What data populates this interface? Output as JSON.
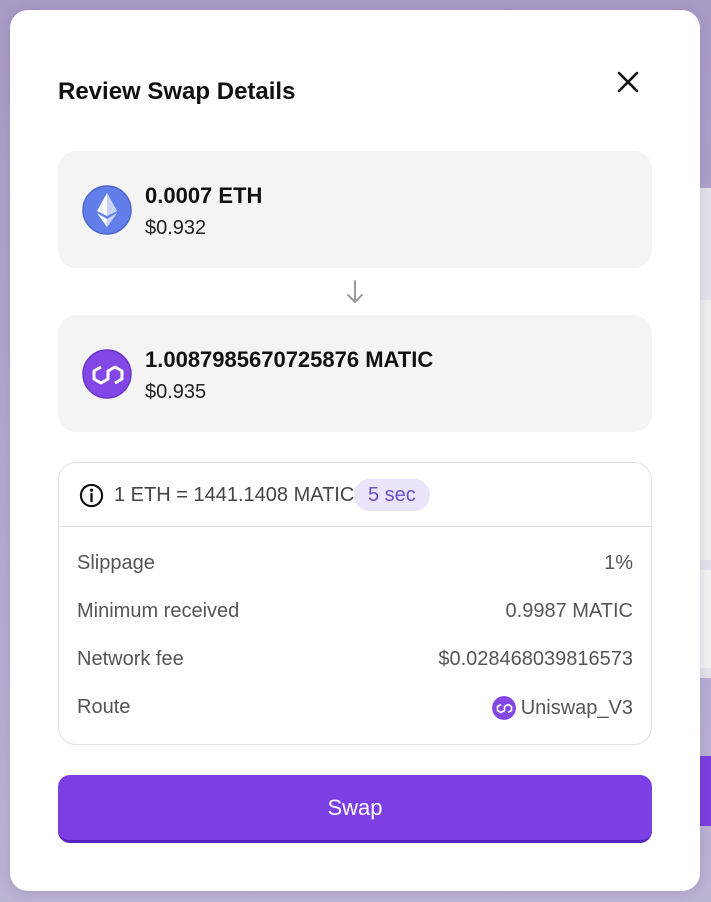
{
  "modal": {
    "title": "Review Swap Details"
  },
  "from_token": {
    "amount": "0.0007 ETH",
    "usd_value": "$0.932",
    "icon": "ethereum-icon"
  },
  "to_token": {
    "amount": "1.0087985670725876 MATIC",
    "usd_value": "$0.935",
    "icon": "polygon-icon"
  },
  "details": {
    "rate": "1 ETH = 1441.1408 MATIC",
    "timer": "5 sec",
    "rows": [
      {
        "label": "Slippage",
        "value": "1%"
      },
      {
        "label": "Minimum received",
        "value": "0.9987 MATIC"
      },
      {
        "label": "Network fee",
        "value": "$0.028468039816573"
      },
      {
        "label": "Route",
        "value": "Uniswap_V3"
      }
    ]
  },
  "actions": {
    "swap_label": "Swap"
  },
  "colors": {
    "accent": "#7b3fe4",
    "eth": "#627eea",
    "matic": "#8247e5",
    "badge_bg": "#ece4fb"
  }
}
